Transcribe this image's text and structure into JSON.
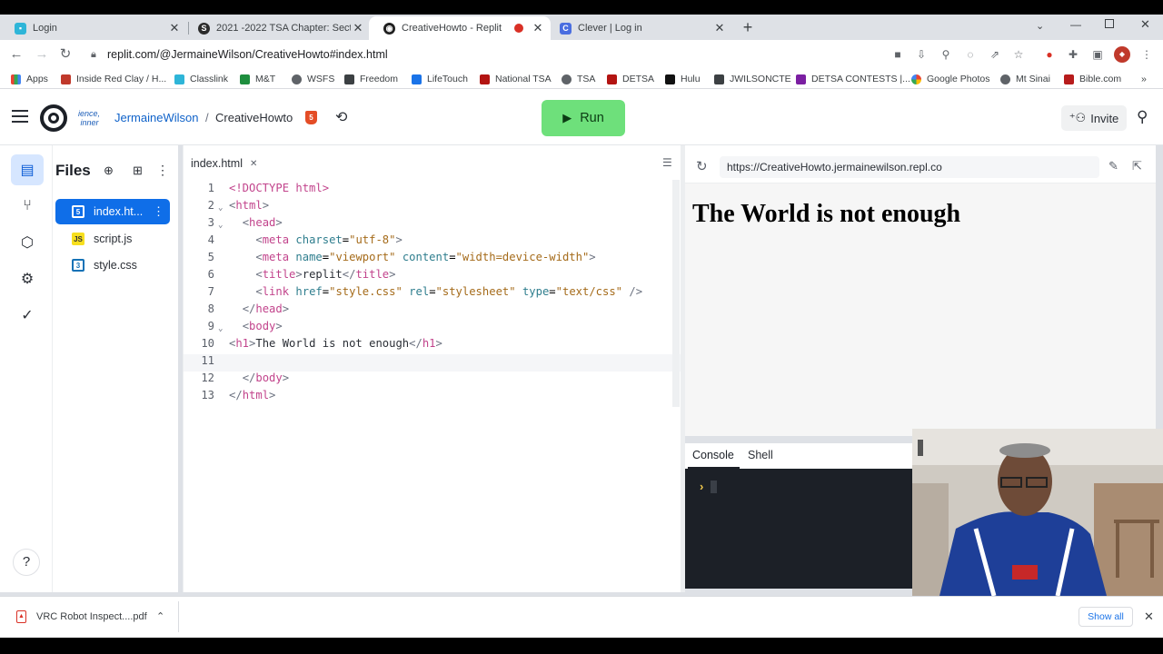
{
  "browser": {
    "tabs": [
      {
        "title": "Login",
        "icon": "replit-login-icon",
        "color": "#2eb5d8"
      },
      {
        "title": "2021 -2022 TSA Chapter: Section",
        "icon": "sharepoint-icon",
        "color": "#1f1f1f"
      },
      {
        "title": "CreativeHowto - Replit",
        "icon": "replit-icon",
        "color": "#1f1f1f"
      },
      {
        "title": "Clever | Log in",
        "icon": "clever-icon",
        "color": "#4a6ee0"
      }
    ],
    "url": "replit.com/@JermaineWilson/CreativeHowto#index.html",
    "bookmarks": [
      "Apps",
      "Inside Red Clay / H...",
      "Classlink",
      "M&T",
      "WSFS",
      "Freedom",
      "LifeTouch",
      "National TSA",
      "TSA",
      "DETSA",
      "Hulu",
      "JWILSONCTE",
      "DETSA CONTESTS |...",
      "Google Photos",
      "Mt Sinai",
      "Bible.com"
    ]
  },
  "replit": {
    "logo_text": "ience, ...inner",
    "user": "JermaineWilson",
    "separator": "/",
    "repl_name": "CreativeHowto",
    "run_label": "Run",
    "invite_label": "Invite",
    "files_title": "Files",
    "files": [
      {
        "name": "index.ht...",
        "type": "html"
      },
      {
        "name": "script.js",
        "type": "js"
      },
      {
        "name": "style.css",
        "type": "css"
      }
    ],
    "editor_tab": "index.html",
    "code_lines": [
      {
        "n": "1",
        "text": "<!DOCTYPE html>"
      },
      {
        "n": "2",
        "text": "<html>"
      },
      {
        "n": "3",
        "text": "  <head>"
      },
      {
        "n": "4",
        "text": "    <meta charset=\"utf-8\">"
      },
      {
        "n": "5",
        "text": "    <meta name=\"viewport\" content=\"width=device-width\">"
      },
      {
        "n": "6",
        "text": "    <title>replit</title>"
      },
      {
        "n": "7",
        "text": "    <link href=\"style.css\" rel=\"stylesheet\" type=\"text/css\" />"
      },
      {
        "n": "8",
        "text": "  </head>"
      },
      {
        "n": "9",
        "text": "  <body>"
      },
      {
        "n": "10",
        "text": "<h1>The World is not enough</h1>"
      },
      {
        "n": "11",
        "text": ""
      },
      {
        "n": "12",
        "text": "  </body>"
      },
      {
        "n": "13",
        "text": "</html>"
      }
    ],
    "webview_url": "https://CreativeHowto.jermainewilson.repl.co",
    "webview_heading": "The World is not enough",
    "console_tab": "Console",
    "shell_tab": "Shell",
    "console_prompt": "›"
  },
  "downloads": {
    "file": "VRC Robot Inspect....pdf",
    "show_all": "Show all"
  }
}
